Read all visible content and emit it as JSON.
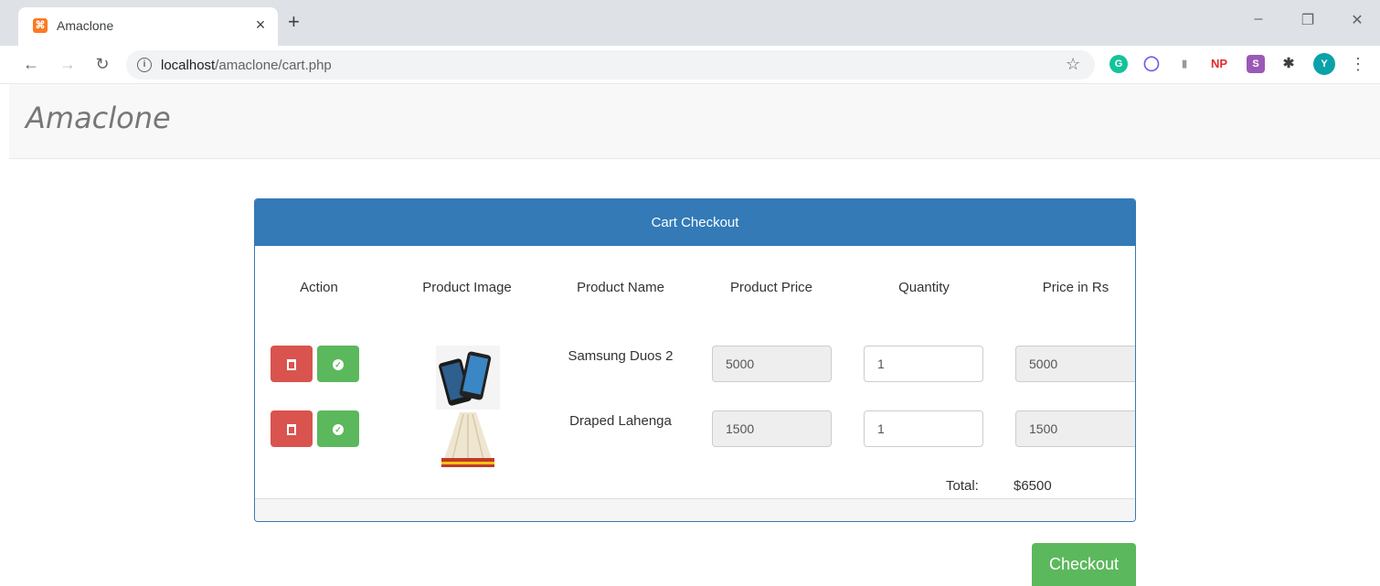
{
  "browser": {
    "tab_title": "Amaclone",
    "tab_close": "×",
    "new_tab": "+",
    "url_host": "localhost",
    "url_path": "/amaclone/cart.php",
    "minimize": "–",
    "restore": "❐",
    "close": "✕",
    "extensions": [
      {
        "label": "G",
        "color": "#15c39a"
      },
      {
        "label": "◯",
        "color": "#ffffff"
      },
      {
        "label": "▮",
        "color": "#ffffff"
      },
      {
        "label": "NP",
        "color": "#ffffff"
      },
      {
        "label": "S",
        "color": "#9b59b6"
      },
      {
        "label": "✱",
        "color": "#ffffff"
      },
      {
        "label": "Y",
        "color": "#0aa2a8"
      }
    ]
  },
  "navbar": {
    "brand": "Amaclone"
  },
  "panel": {
    "title": "Cart Checkout",
    "headers": [
      "Action",
      "Product Image",
      "Product Name",
      "Product Price",
      "Quantity",
      "Price in Rs"
    ],
    "rows": [
      {
        "name": "Samsung Duos 2",
        "price": "5000",
        "quantity": "1",
        "total": "5000"
      },
      {
        "name": "Draped Lahenga",
        "price": "1500",
        "quantity": "1",
        "total": "1500"
      }
    ],
    "total_label": "Total:",
    "total_value": "$6500"
  },
  "checkout_label": "Checkout",
  "colors": {
    "primary": "#337ab7",
    "danger": "#d9534f",
    "success": "#5cb85c"
  }
}
